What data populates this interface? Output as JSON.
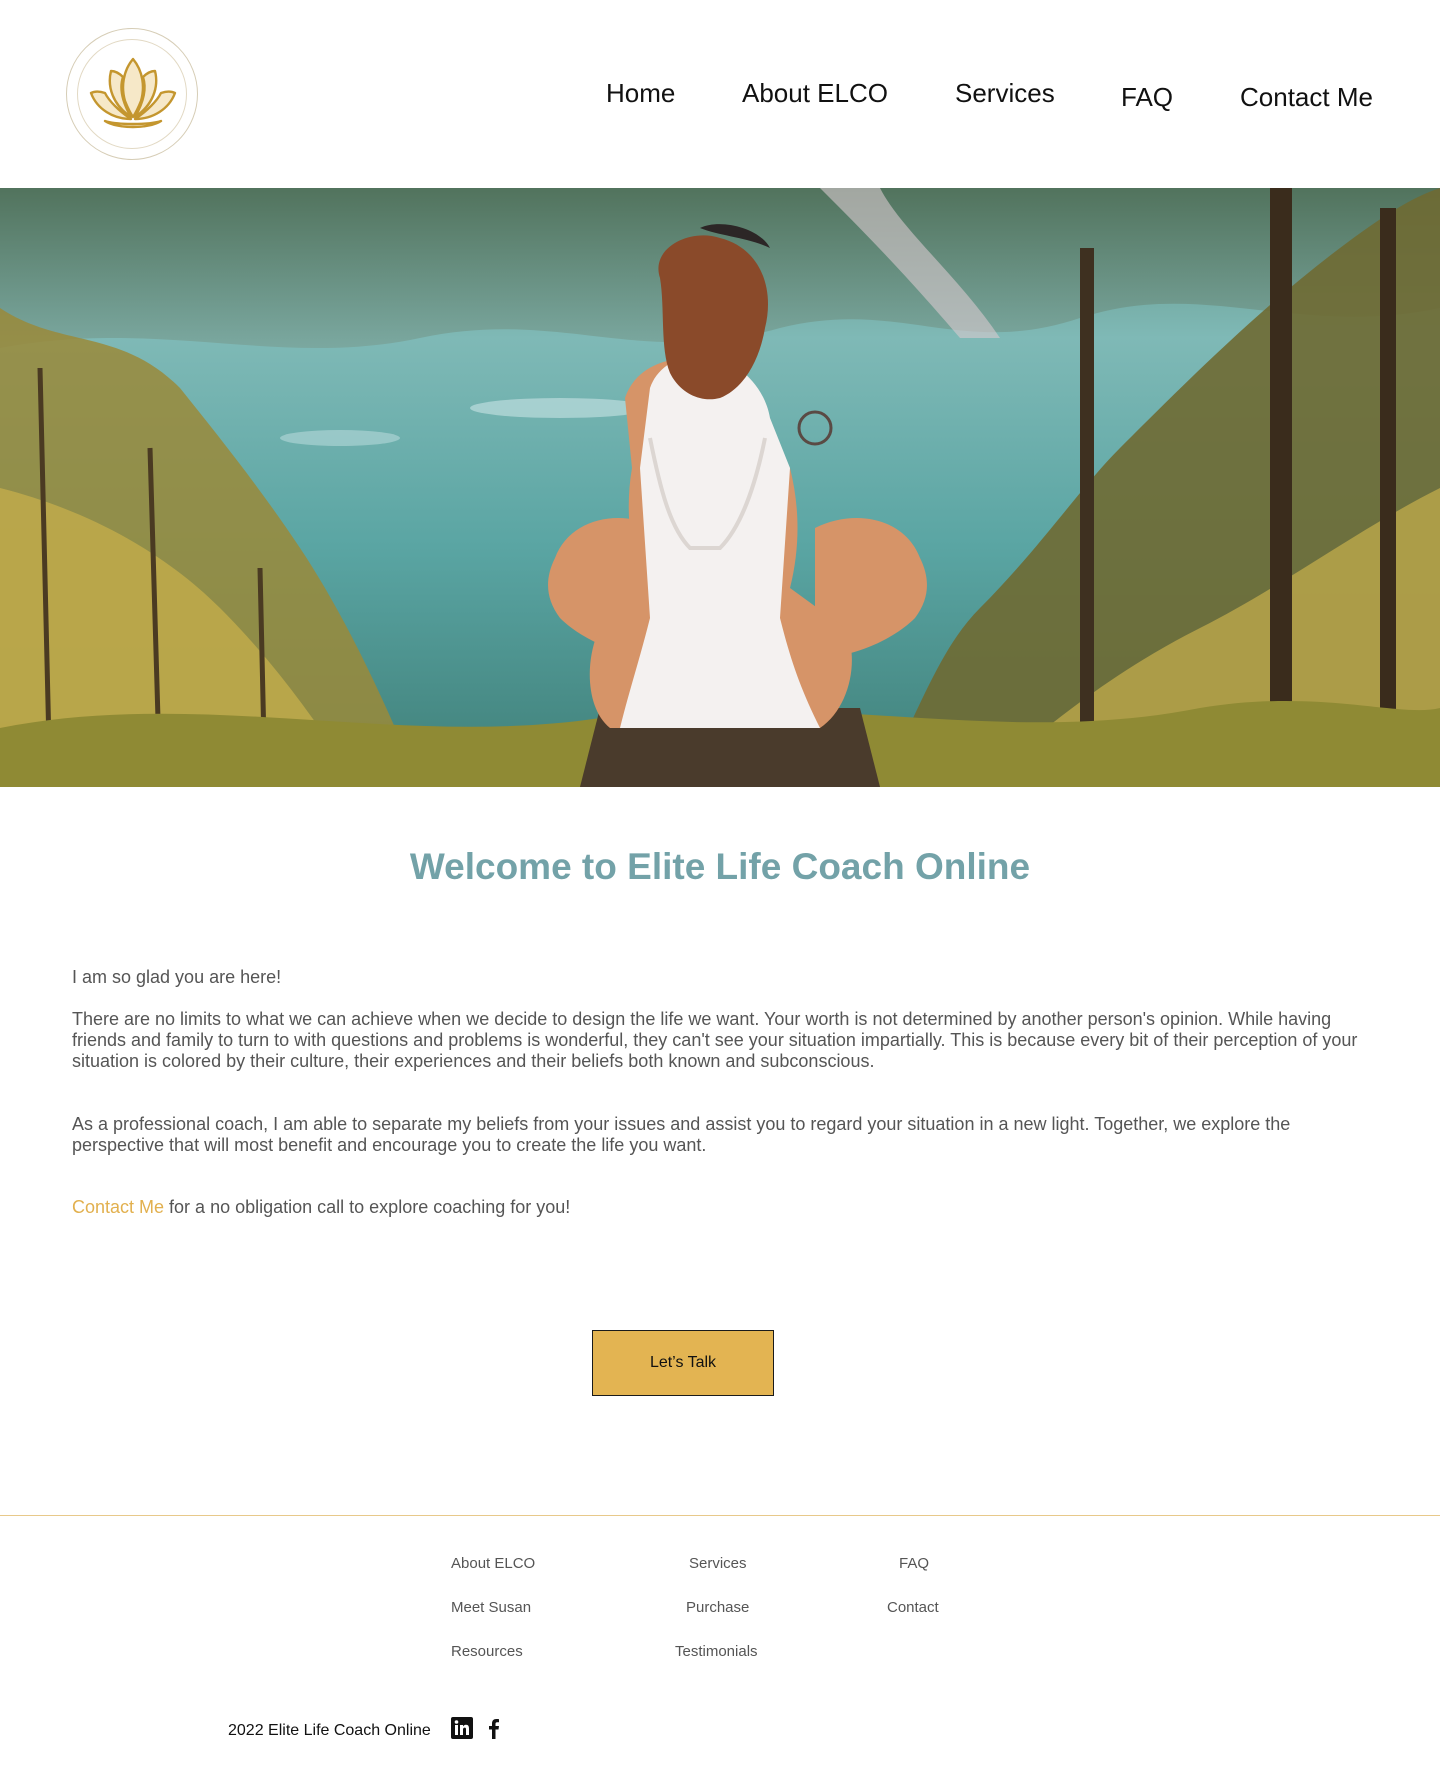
{
  "header": {
    "nav": [
      {
        "label": "Home"
      },
      {
        "label": "About ELCO"
      },
      {
        "label": "Services"
      },
      {
        "label": "FAQ"
      },
      {
        "label": "Contact Me"
      }
    ]
  },
  "hero": {
    "image": "woman-sitting-by-lake-photo"
  },
  "main": {
    "title": "Welcome to Elite Life Coach Online",
    "intro": "I am so glad you are here!",
    "paragraph1": "There are no limits to what we can achieve when we decide to design the life we want. Your worth is not determined by another person's opinion. While having friends and family to turn to with questions and problems is wonderful, they can't see your situation impartially. This is because every bit of their perception of your situation is colored by their culture, their experiences and their beliefs both known and subconscious.",
    "paragraph2": "As a professional coach, I am able to separate my beliefs from your issues and assist you to regard your situation in a new light. Together, we explore the perspective that will most benefit and encourage you to create the life you want.",
    "contact_link": "Contact Me",
    "contact_rest": " for a no obligation call to explore coaching for you!",
    "cta_label": "Let’s Talk"
  },
  "footer": {
    "col1": [
      "About ELCO",
      "Meet Susan",
      "Resources"
    ],
    "col2": [
      "Services",
      "Purchase",
      "Testimonials"
    ],
    "col3": [
      "FAQ",
      "Contact"
    ],
    "copyright": "2022 Elite Life Coach Online",
    "social": [
      "linkedin-icon",
      "facebook-icon"
    ]
  },
  "colors": {
    "accent_gold": "#e3b452",
    "title_teal": "#73a2a8",
    "body_text": "#555555"
  }
}
